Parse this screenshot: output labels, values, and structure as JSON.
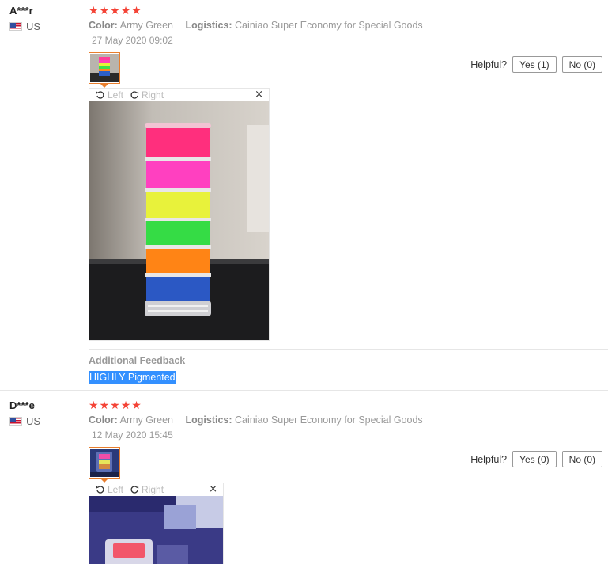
{
  "reviews": [
    {
      "user": "A***r",
      "country": "US",
      "rating_stars": 5,
      "color_label": "Color:",
      "color_value": "Army Green",
      "logistics_label": "Logistics:",
      "logistics_value": "Cainiao Super Economy for Special Goods",
      "date": "27 May 2020 09:02",
      "helpful_label": "Helpful?",
      "yes_label": "Yes (1)",
      "no_label": "No (0)",
      "viewer": {
        "rotate_left": "Left",
        "rotate_right": "Right",
        "close": "×"
      },
      "feedback_title": "Additional Feedback",
      "feedback_text": "HIGHLY Pigmented"
    },
    {
      "user": "D***e",
      "country": "US",
      "rating_stars": 5,
      "color_label": "Color:",
      "color_value": "Army Green",
      "logistics_label": "Logistics:",
      "logistics_value": "Cainiao Super Economy for Special Goods",
      "date": "12 May 2020 15:45",
      "helpful_label": "Helpful?",
      "yes_label": "Yes (0)",
      "no_label": "No (0)",
      "viewer": {
        "rotate_left": "Left",
        "rotate_right": "Right",
        "close": "×"
      }
    }
  ],
  "colors": {
    "star": "#f44336",
    "thumb_border": "#e87e2d",
    "selection": "#3390ff"
  },
  "icons": {
    "flag": "us-flag-icon",
    "star": "star-icon",
    "rotate_left": "rotate-left-icon",
    "rotate_right": "rotate-right-icon",
    "close": "close-icon"
  }
}
